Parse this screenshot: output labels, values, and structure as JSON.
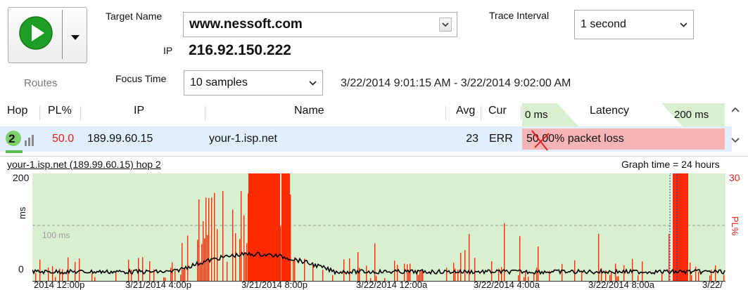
{
  "toolbar": {
    "routes_label": "Routes",
    "target_name_label": "Target Name",
    "target_name_value": "www.nessoft.com",
    "ip_label": "IP",
    "ip_value": "216.92.150.222",
    "focus_time_label": "Focus Time",
    "focus_time_value": "10 samples",
    "time_range": "3/22/2014 9:01:15 AM - 3/22/2014 9:02:00 AM",
    "trace_interval_label": "Trace Interval",
    "trace_interval_value": "1 second"
  },
  "table": {
    "headers": {
      "hop": "Hop",
      "pl": "PL%",
      "ip": "IP",
      "name": "Name",
      "avg": "Avg",
      "cur": "Cur",
      "latency_min": "0 ms",
      "latency": "Latency",
      "latency_max": "200 ms"
    },
    "rows": [
      {
        "hop": "2",
        "pl": "50.0",
        "ip": "189.99.60.15",
        "name": "your-1.isp.net",
        "avg": "23",
        "cur": "ERR",
        "latency_text": "50.00% packet loss"
      }
    ]
  },
  "graph": {
    "title": "your-1.isp.net (189.99.60.15) hop 2",
    "graph_time": "Graph time = 24 hours",
    "y_left_max": "200",
    "y_left_zero": "0",
    "y_left_label": "ms",
    "threshold_label": "100 ms",
    "y_right_max": "30",
    "y_right_label": "PL%",
    "x_ticks": [
      "2014 12:00p",
      "3/21/2014 4:00p",
      "3/21/2014 8:00p",
      "3/22/2014 12:00a",
      "3/22/2014 4:00a",
      "3/22/2014 8:00a",
      "3/22/"
    ]
  },
  "colors": {
    "accent_green": "#1e9e25",
    "row_highlight": "#e1eefb",
    "packet_loss_bar": "#f7b4b4",
    "pl_red": "#ff2a00",
    "graph_bg": "#d9f0d0",
    "latency_line": "#000000",
    "pl_text_red": "#e0201b"
  }
}
